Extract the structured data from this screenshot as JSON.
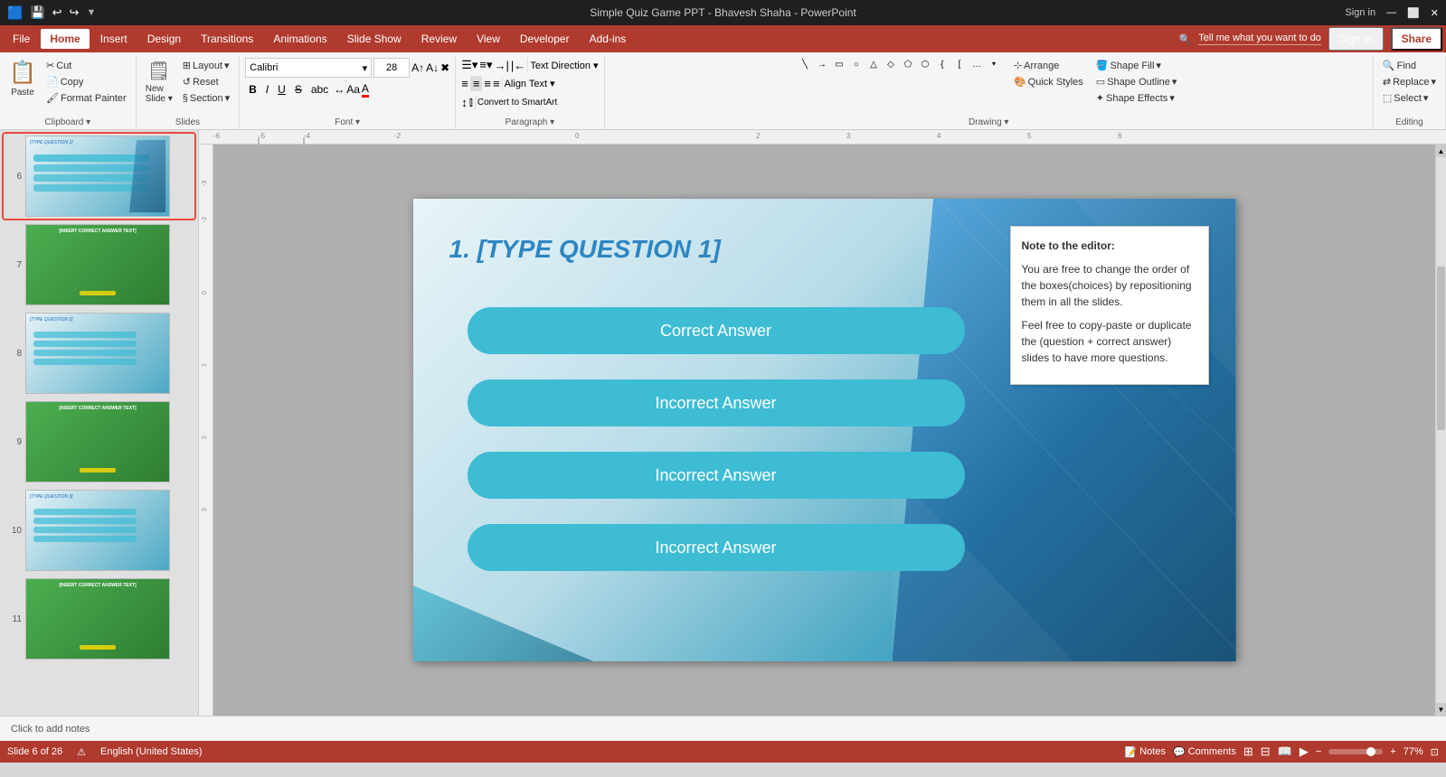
{
  "titlebar": {
    "title": "Simple Quiz Game PPT - Bhavesh Shaha - PowerPoint",
    "save_icon": "💾",
    "undo_icon": "↩",
    "redo_icon": "↪",
    "signin": "Sign in",
    "share": "Share"
  },
  "menubar": {
    "items": [
      "File",
      "Home",
      "Insert",
      "Design",
      "Transitions",
      "Animations",
      "Slide Show",
      "Review",
      "View",
      "Developer",
      "Add-ins"
    ],
    "active": "Home",
    "tell_me": "Tell me what you want to do",
    "signin": "Sign in",
    "share": "Share"
  },
  "ribbon": {
    "clipboard": {
      "label": "Clipboard",
      "paste": "Paste",
      "cut": "Cut",
      "copy": "Copy",
      "format_painter": "Format Painter"
    },
    "slides": {
      "label": "Slides",
      "new_slide": "New\nSlide",
      "layout": "Layout",
      "reset": "Reset",
      "section": "Section"
    },
    "font": {
      "label": "Font",
      "font_name": "Calibri",
      "font_size": "28"
    },
    "paragraph": {
      "label": "Paragraph",
      "text_direction": "Text Direction",
      "align_text": "Align Text",
      "convert": "Convert to SmartArt",
      "text_align": "Text Align"
    },
    "drawing": {
      "label": "Drawing",
      "arrange": "Arrange",
      "quick_styles": "Quick\nStyles",
      "shape_fill": "Shape Fill",
      "shape_outline": "Shape Outline",
      "shape_effects": "Shape Effects"
    },
    "editing": {
      "label": "Editing",
      "find": "Find",
      "replace": "Replace",
      "select": "Select"
    }
  },
  "slide": {
    "current_number": 6,
    "total": 26,
    "title": "1.  [TYPE QUESTION 1]",
    "answers": [
      {
        "label": "Correct Answer",
        "type": "correct"
      },
      {
        "label": "Incorrect Answer",
        "type": "incorrect"
      },
      {
        "label": "Incorrect Answer",
        "type": "incorrect"
      },
      {
        "label": "Incorrect Answer",
        "type": "incorrect"
      }
    ],
    "note": {
      "heading": "Note to the editor:",
      "line1": "You are free to change the order of the boxes(choices) by repositioning them in all the slides.",
      "line2": "Feel free to copy-paste or duplicate the (question + correct answer) slides to have more questions."
    }
  },
  "sidebar": {
    "slides": [
      {
        "num": "6",
        "active": true
      },
      {
        "num": "7",
        "active": false
      },
      {
        "num": "8",
        "active": false
      },
      {
        "num": "9",
        "active": false
      },
      {
        "num": "10",
        "active": false
      },
      {
        "num": "11",
        "active": false
      }
    ]
  },
  "statusbar": {
    "slide_info": "Slide 6 of 26",
    "spell_check": "English (United States)",
    "notes": "Notes",
    "comments": "Comments",
    "zoom": "77%",
    "click_notes": "Click to add notes"
  }
}
